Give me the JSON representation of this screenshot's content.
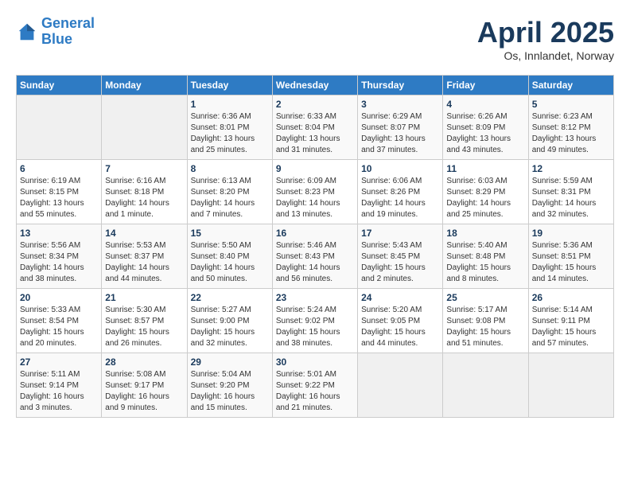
{
  "header": {
    "logo_line1": "General",
    "logo_line2": "Blue",
    "title": "April 2025",
    "subtitle": "Os, Innlandet, Norway"
  },
  "weekdays": [
    "Sunday",
    "Monday",
    "Tuesday",
    "Wednesday",
    "Thursday",
    "Friday",
    "Saturday"
  ],
  "weeks": [
    [
      {
        "num": "",
        "info": ""
      },
      {
        "num": "",
        "info": ""
      },
      {
        "num": "1",
        "info": "Sunrise: 6:36 AM\nSunset: 8:01 PM\nDaylight: 13 hours\nand 25 minutes."
      },
      {
        "num": "2",
        "info": "Sunrise: 6:33 AM\nSunset: 8:04 PM\nDaylight: 13 hours\nand 31 minutes."
      },
      {
        "num": "3",
        "info": "Sunrise: 6:29 AM\nSunset: 8:07 PM\nDaylight: 13 hours\nand 37 minutes."
      },
      {
        "num": "4",
        "info": "Sunrise: 6:26 AM\nSunset: 8:09 PM\nDaylight: 13 hours\nand 43 minutes."
      },
      {
        "num": "5",
        "info": "Sunrise: 6:23 AM\nSunset: 8:12 PM\nDaylight: 13 hours\nand 49 minutes."
      }
    ],
    [
      {
        "num": "6",
        "info": "Sunrise: 6:19 AM\nSunset: 8:15 PM\nDaylight: 13 hours\nand 55 minutes."
      },
      {
        "num": "7",
        "info": "Sunrise: 6:16 AM\nSunset: 8:18 PM\nDaylight: 14 hours\nand 1 minute."
      },
      {
        "num": "8",
        "info": "Sunrise: 6:13 AM\nSunset: 8:20 PM\nDaylight: 14 hours\nand 7 minutes."
      },
      {
        "num": "9",
        "info": "Sunrise: 6:09 AM\nSunset: 8:23 PM\nDaylight: 14 hours\nand 13 minutes."
      },
      {
        "num": "10",
        "info": "Sunrise: 6:06 AM\nSunset: 8:26 PM\nDaylight: 14 hours\nand 19 minutes."
      },
      {
        "num": "11",
        "info": "Sunrise: 6:03 AM\nSunset: 8:29 PM\nDaylight: 14 hours\nand 25 minutes."
      },
      {
        "num": "12",
        "info": "Sunrise: 5:59 AM\nSunset: 8:31 PM\nDaylight: 14 hours\nand 32 minutes."
      }
    ],
    [
      {
        "num": "13",
        "info": "Sunrise: 5:56 AM\nSunset: 8:34 PM\nDaylight: 14 hours\nand 38 minutes."
      },
      {
        "num": "14",
        "info": "Sunrise: 5:53 AM\nSunset: 8:37 PM\nDaylight: 14 hours\nand 44 minutes."
      },
      {
        "num": "15",
        "info": "Sunrise: 5:50 AM\nSunset: 8:40 PM\nDaylight: 14 hours\nand 50 minutes."
      },
      {
        "num": "16",
        "info": "Sunrise: 5:46 AM\nSunset: 8:43 PM\nDaylight: 14 hours\nand 56 minutes."
      },
      {
        "num": "17",
        "info": "Sunrise: 5:43 AM\nSunset: 8:45 PM\nDaylight: 15 hours\nand 2 minutes."
      },
      {
        "num": "18",
        "info": "Sunrise: 5:40 AM\nSunset: 8:48 PM\nDaylight: 15 hours\nand 8 minutes."
      },
      {
        "num": "19",
        "info": "Sunrise: 5:36 AM\nSunset: 8:51 PM\nDaylight: 15 hours\nand 14 minutes."
      }
    ],
    [
      {
        "num": "20",
        "info": "Sunrise: 5:33 AM\nSunset: 8:54 PM\nDaylight: 15 hours\nand 20 minutes."
      },
      {
        "num": "21",
        "info": "Sunrise: 5:30 AM\nSunset: 8:57 PM\nDaylight: 15 hours\nand 26 minutes."
      },
      {
        "num": "22",
        "info": "Sunrise: 5:27 AM\nSunset: 9:00 PM\nDaylight: 15 hours\nand 32 minutes."
      },
      {
        "num": "23",
        "info": "Sunrise: 5:24 AM\nSunset: 9:02 PM\nDaylight: 15 hours\nand 38 minutes."
      },
      {
        "num": "24",
        "info": "Sunrise: 5:20 AM\nSunset: 9:05 PM\nDaylight: 15 hours\nand 44 minutes."
      },
      {
        "num": "25",
        "info": "Sunrise: 5:17 AM\nSunset: 9:08 PM\nDaylight: 15 hours\nand 51 minutes."
      },
      {
        "num": "26",
        "info": "Sunrise: 5:14 AM\nSunset: 9:11 PM\nDaylight: 15 hours\nand 57 minutes."
      }
    ],
    [
      {
        "num": "27",
        "info": "Sunrise: 5:11 AM\nSunset: 9:14 PM\nDaylight: 16 hours\nand 3 minutes."
      },
      {
        "num": "28",
        "info": "Sunrise: 5:08 AM\nSunset: 9:17 PM\nDaylight: 16 hours\nand 9 minutes."
      },
      {
        "num": "29",
        "info": "Sunrise: 5:04 AM\nSunset: 9:20 PM\nDaylight: 16 hours\nand 15 minutes."
      },
      {
        "num": "30",
        "info": "Sunrise: 5:01 AM\nSunset: 9:22 PM\nDaylight: 16 hours\nand 21 minutes."
      },
      {
        "num": "",
        "info": ""
      },
      {
        "num": "",
        "info": ""
      },
      {
        "num": "",
        "info": ""
      }
    ]
  ]
}
